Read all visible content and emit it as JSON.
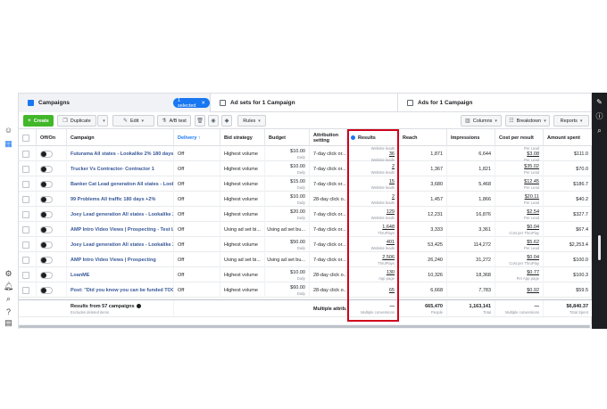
{
  "tabs": {
    "campaigns": "Campaigns",
    "selected": "1 selected",
    "adsets": "Ad sets for 1 Campaign",
    "ads": "Ads for 1 Campaign"
  },
  "toolbar": {
    "create": "Create",
    "duplicate": "Duplicate",
    "edit": "Edit",
    "ab_test": "A/B test",
    "rules": "Rules",
    "columns": "Columns",
    "breakdown": "Breakdown",
    "reports": "Reports"
  },
  "columns": {
    "onoff": "Off/On",
    "campaign": "Campaign",
    "delivery": "Delivery ↑",
    "bid": "Bid strategy",
    "budget": "Budget",
    "attribution": "Attribution setting",
    "results": "Results",
    "reach": "Reach",
    "impressions": "Impressions",
    "cpr": "Cost per result",
    "spent": "Amount spent"
  },
  "rows": [
    {
      "campaign": "Futurama All states - Lookalike 2% 180 days",
      "delivery": "Off",
      "bid": "Highest volume",
      "budget": "$10.00",
      "budget_sub": "Daily",
      "attr": "7-day click or...",
      "results_pre": "Website leads",
      "results": "36",
      "results_sub": "Website leads",
      "reach": "1,871",
      "impr": "6,644",
      "cpr": "$3.08",
      "cpr_pre": "Per Lead",
      "cpr_sub": "Per Lead",
      "spent": "$111.0"
    },
    {
      "campaign": "Trucker Vs Contractor- Contractor 1",
      "delivery": "Off",
      "bid": "Highest volume",
      "budget": "$10.00",
      "budget_sub": "Daily",
      "attr": "7-day click or...",
      "results": "2",
      "results_sub": "Website leads",
      "reach": "1,367",
      "impr": "1,821",
      "cpr": "$35.02",
      "cpr_sub": "Per Lead",
      "spent": "$70.0"
    },
    {
      "campaign": "Banker Cat Lead generation All states - Lookalike 2%",
      "delivery": "Off",
      "bid": "Highest volume",
      "budget": "$15.00",
      "budget_sub": "Daily",
      "attr": "7-day click or...",
      "results": "15",
      "results_sub": "Website leads",
      "reach": "3,680",
      "impr": "5,468",
      "cpr": "$12.45",
      "cpr_sub": "Per Lead",
      "spent": "$186.7"
    },
    {
      "campaign": "99 Problems All traffic 180 days +2%",
      "delivery": "Off",
      "bid": "Highest volume",
      "budget": "$10.00",
      "budget_sub": "Daily",
      "attr": "28-day click o...",
      "results": "2",
      "results_sub": "Website leads",
      "reach": "1,457",
      "impr": "1,866",
      "cpr": "$20.11",
      "cpr_sub": "Per Lead",
      "spent": "$40.2"
    },
    {
      "campaign": "Joey Lead generation All states - Lookalike 2%",
      "delivery": "Off",
      "bid": "Highest volume",
      "budget": "$20.00",
      "budget_sub": "Daily",
      "attr": "7-day click or...",
      "results": "129",
      "results_sub": "Website leads",
      "reach": "12,231",
      "impr": "16,876",
      "cpr": "$2.54",
      "cpr_sub": "Per Lead",
      "spent": "$327.7"
    },
    {
      "campaign": "AMP Intro Video Views | Prospecting - Test L...",
      "delivery": "Off",
      "bid": "Using ad set bi...",
      "budget": "Using ad set bu...",
      "budget_sub": "",
      "attr": "7-day click or...",
      "results": "1,648",
      "results_sub": "ThruPlays",
      "reach": "3,333",
      "impr": "3,361",
      "cpr": "$0.04",
      "cpr_sub": "Cost per ThruPlay",
      "spent": "$67.4"
    },
    {
      "campaign": "Joey Lead generation All states - Lookalike 2%",
      "delivery": "Off",
      "bid": "Highest volume",
      "budget": "$50.00",
      "budget_sub": "Daily",
      "attr": "7-day click or...",
      "results": "401",
      "results_sub": "Website leads",
      "reach": "53,425",
      "impr": "114,272",
      "cpr": "$5.62",
      "cpr_sub": "Per Lead",
      "spent": "$2,253.4"
    },
    {
      "campaign": "AMP Intro Video Views | Prospecting",
      "delivery": "Off",
      "bid": "Using ad set bi...",
      "budget": "Using ad set bu...",
      "budget_sub": "",
      "attr": "7-day click or...",
      "results": "2,506",
      "results_sub": "ThruPlays",
      "reach": "26,240",
      "impr": "31,272",
      "cpr": "$0.04",
      "cpr_sub": "Cost per ThruPlay",
      "spent": "$100.0"
    },
    {
      "campaign": "LoanME",
      "delivery": "Off",
      "bid": "Highest volume",
      "budget": "$10.00",
      "budget_sub": "Daily",
      "attr": "28-day click o...",
      "results": "130",
      "results_sub": "App page",
      "reach": "10,326",
      "impr": "18,368",
      "cpr": "$0.77",
      "cpr_sub": "Per App page",
      "spent": "$100.3"
    },
    {
      "campaign": "Post: \"Did you know you can be funded TOGE...",
      "delivery": "Off",
      "bid": "Highest volume",
      "budget": "$60.00",
      "budget_sub": "Daily",
      "attr": "28-day click o...",
      "results": "65",
      "results_sub": "",
      "reach": "6,668",
      "impr": "7,783",
      "cpr": "$0.92",
      "cpr_sub": "",
      "spent": "$59.5"
    }
  ],
  "totals": {
    "label": "Results from 57 campaigns",
    "sub": "Excludes deleted items",
    "attr": "Multiple attrib...",
    "results": "—",
    "results_sub": "Multiple conversions",
    "reach": "665,470",
    "reach_sub": "People",
    "impr": "1,163,141",
    "impr_sub": "Total",
    "cpr": "—",
    "cpr_sub": "Multiple conversions",
    "spent": "$6,840.37",
    "spent_sub": "Total Spent"
  },
  "colors": {
    "accent": "#1877f2",
    "create": "#42b72a",
    "highlight": "#d0021b"
  },
  "icons": {
    "left_rail": [
      "smiley-icon",
      "grid-icon",
      "settings-icon",
      "bell-icon",
      "search-icon",
      "help-icon",
      "report-icon"
    ],
    "right_rail": [
      "edit-icon",
      "info-icon",
      "search-icon"
    ]
  }
}
